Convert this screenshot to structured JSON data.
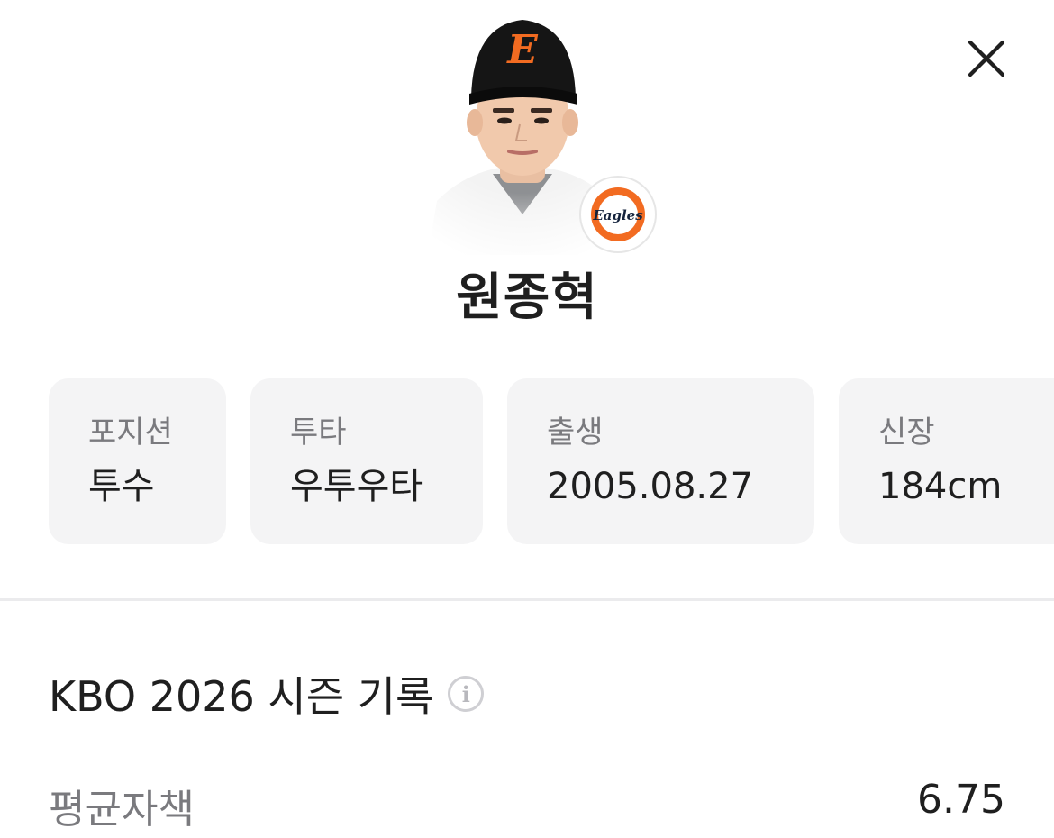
{
  "player": {
    "name": "원종혁",
    "team_badge_text": "Eagles",
    "cap_letter": "E"
  },
  "info_cards": [
    {
      "label": "포지션",
      "value": "투수"
    },
    {
      "label": "투타",
      "value": "우투우타"
    },
    {
      "label": "출생",
      "value": "2005.08.27"
    },
    {
      "label": "신장",
      "value": "184cm"
    }
  ],
  "season": {
    "title": "KBO 2026 시즌 기록",
    "info_glyph": "i",
    "stats": [
      {
        "label": "평균자책",
        "value": "6.75"
      }
    ]
  },
  "colors": {
    "team_orange": "#f26b21",
    "card_bg": "#f4f4f5",
    "label_gray": "#7a7a7e"
  },
  "icons": {
    "close": "close-icon",
    "info": "info-icon"
  }
}
